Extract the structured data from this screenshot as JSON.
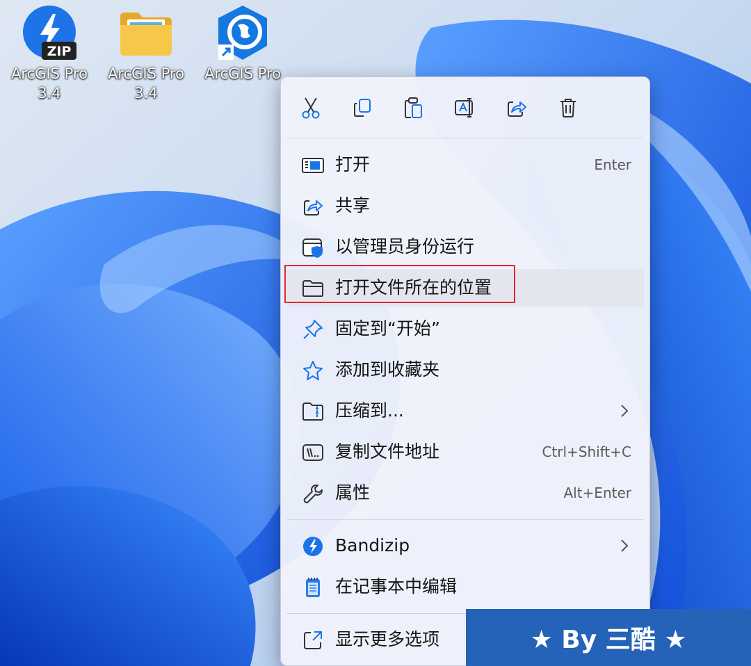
{
  "desktop": {
    "icons": [
      {
        "name": "ArcGIS Pro",
        "line2": "3.4",
        "kind": "zip",
        "badge": "ZIP"
      },
      {
        "name": "ArcGIS Pro",
        "line2": "3.4",
        "kind": "folder"
      },
      {
        "name": "ArcGIS Pro",
        "line2": "",
        "kind": "shortcut"
      }
    ]
  },
  "quick_actions": [
    {
      "icon": "cut-icon"
    },
    {
      "icon": "copy-icon"
    },
    {
      "icon": "paste-icon"
    },
    {
      "icon": "rename-icon"
    },
    {
      "icon": "share-icon"
    },
    {
      "icon": "delete-icon"
    }
  ],
  "menu": {
    "items": [
      {
        "label": "打开",
        "shortcut": "Enter",
        "icon": "open-app-icon"
      },
      {
        "label": "共享",
        "shortcut": "",
        "icon": "share-icon"
      },
      {
        "label": "以管理员身份运行",
        "shortcut": "",
        "icon": "admin-shield-icon"
      },
      {
        "label": "打开文件所在的位置",
        "shortcut": "",
        "icon": "folder-icon",
        "highlighted": true
      },
      {
        "label": "固定到“开始”",
        "shortcut": "",
        "icon": "pin-icon"
      },
      {
        "label": "添加到收藏夹",
        "shortcut": "",
        "icon": "star-icon"
      },
      {
        "label": "压缩到...",
        "shortcut": "",
        "icon": "zip-folder-icon",
        "submenu": true
      },
      {
        "label": "复制文件地址",
        "shortcut": "Ctrl+Shift+C",
        "icon": "copy-path-icon"
      },
      {
        "label": "属性",
        "shortcut": "Alt+Enter",
        "icon": "wrench-icon"
      }
    ],
    "extra_items": [
      {
        "label": "Bandizip",
        "icon": "bandizip-icon",
        "submenu": true
      },
      {
        "label": "在记事本中编辑",
        "icon": "notepad-icon"
      }
    ],
    "more_options": {
      "label": "显示更多选项",
      "icon": "more-options-icon"
    }
  },
  "watermark": {
    "text": "★ By 三酷 ★"
  },
  "colors": {
    "accent": "#1a73e8",
    "highlight_border": "#e3262b",
    "watermark_bg": "#2563b8"
  }
}
